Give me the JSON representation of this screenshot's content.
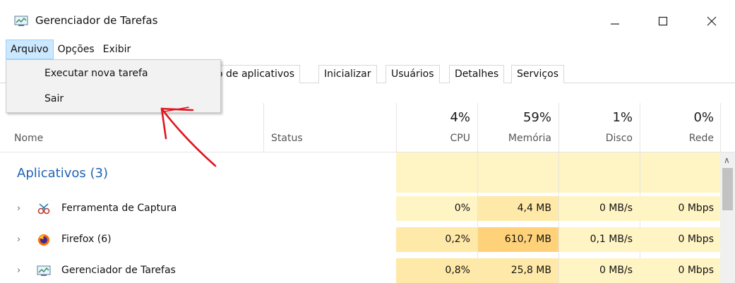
{
  "window": {
    "title": "Gerenciador de Tarefas",
    "controls": {
      "minimize": "—",
      "maximize": "☐",
      "close": "✕"
    }
  },
  "menubar": {
    "items": [
      "Arquivo",
      "Opções",
      "Exibir"
    ]
  },
  "file_menu": {
    "items": [
      "Executar nova tarefa",
      "Sair"
    ]
  },
  "tabs": [
    "o de aplicativos",
    "Inicializar",
    "Usuários",
    "Detalhes",
    "Serviços"
  ],
  "columns": {
    "name": "Nome",
    "status": "Status",
    "cpu": {
      "percent": "4%",
      "label": "CPU"
    },
    "memory": {
      "percent": "59%",
      "label": "Memória"
    },
    "disk": {
      "percent": "1%",
      "label": "Disco"
    },
    "network": {
      "percent": "0%",
      "label": "Rede"
    }
  },
  "group": {
    "title": "Aplicativos (3)"
  },
  "rows": [
    {
      "name": "Ferramenta de Captura",
      "icon": "snipping-tool-icon",
      "cpu": "0%",
      "memory": "4,4 MB",
      "disk": "0 MB/s",
      "network": "0 Mbps"
    },
    {
      "name": "Firefox (6)",
      "icon": "firefox-icon",
      "cpu": "0,2%",
      "memory": "610,7 MB",
      "disk": "0,1 MB/s",
      "network": "0 Mbps"
    },
    {
      "name": "Gerenciador de Tarefas",
      "icon": "task-manager-icon",
      "cpu": "0,8%",
      "memory": "25,8 MB",
      "disk": "0 MB/s",
      "network": "0 Mbps"
    }
  ],
  "colors": {
    "accent_blue": "#1f63b5",
    "heat_light": "#fff4c4",
    "heat_medium": "#ffe9a8",
    "heat_high": "#ffd27a",
    "menu_highlight": "#cce8ff",
    "annotation_red": "#e0141e"
  }
}
